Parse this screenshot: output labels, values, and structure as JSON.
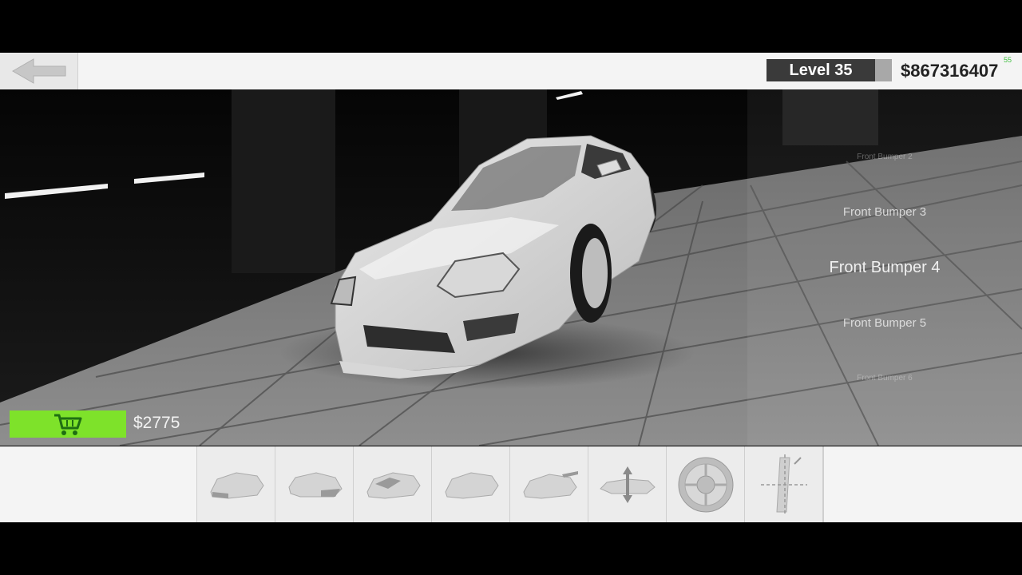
{
  "header": {
    "level_label": "Level 35",
    "money": "$867316407",
    "fps": "55"
  },
  "parts": {
    "items": [
      {
        "label": "Front Bumper 2",
        "state": "faded"
      },
      {
        "label": "Front Bumper 3",
        "state": "normal"
      },
      {
        "label": "Front Bumper 4",
        "state": "selected"
      },
      {
        "label": "Front Bumper 5",
        "state": "normal"
      },
      {
        "label": "Front Bumper 6",
        "state": "faded"
      }
    ]
  },
  "purchase": {
    "price": "$2775",
    "button_color": "#7ee22a"
  },
  "toolbar": {
    "icons": [
      "front-bumper-icon",
      "rear-bumper-icon",
      "hood-icon",
      "side-skirt-icon",
      "spoiler-icon",
      "suspension-height-icon",
      "wheel-icon",
      "camber-icon"
    ]
  },
  "colors": {
    "bar_bg": "#f4f4f4",
    "level_bg": "#3a3a3a",
    "accent_green": "#7ee22a"
  }
}
